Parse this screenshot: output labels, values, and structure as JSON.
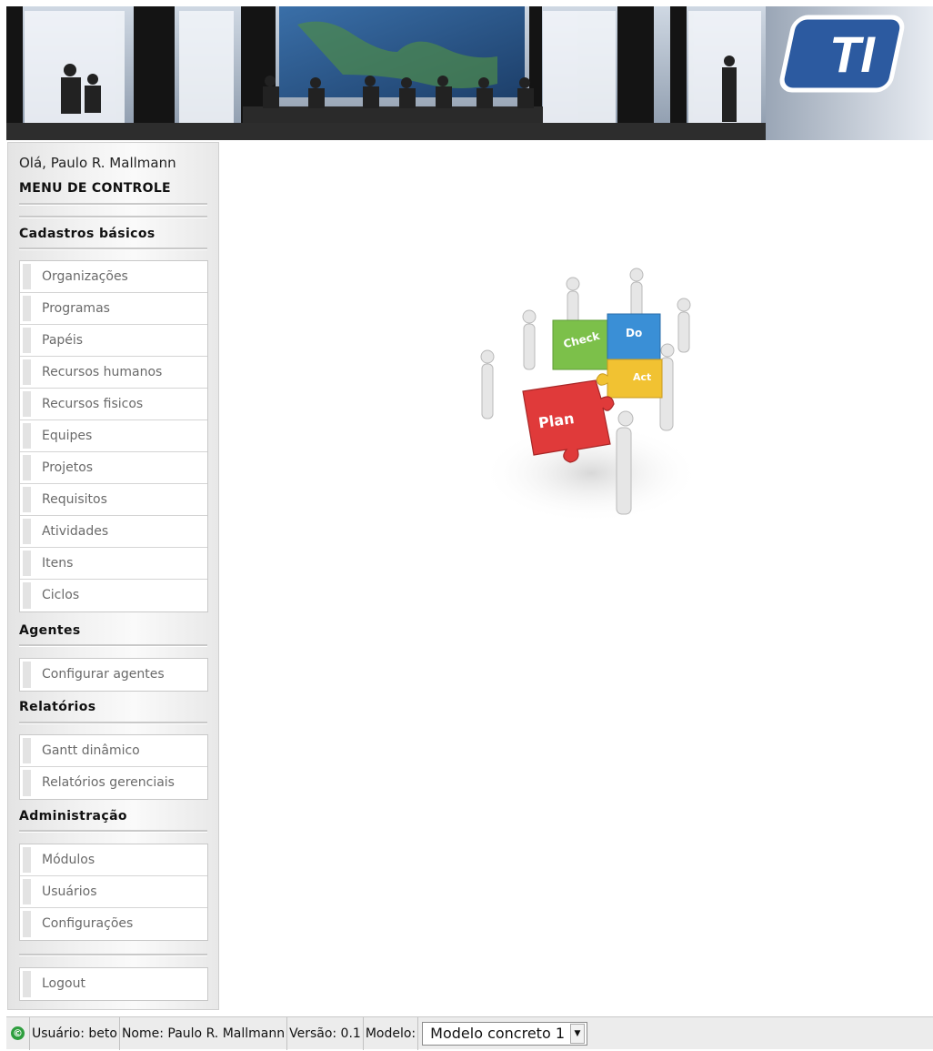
{
  "header": {
    "logo_text": "TI"
  },
  "sidebar": {
    "greeting": "Olá, Paulo R. Mallmann",
    "menu_title": "MENU DE CONTROLE",
    "sections": [
      {
        "title": "Cadastros básicos",
        "items": [
          "Organizações",
          "Programas",
          "Papéis",
          "Recursos humanos",
          "Recursos fisicos",
          "Equipes",
          "Projetos",
          "Requisitos",
          "Atividades",
          "Itens",
          "Ciclos"
        ]
      },
      {
        "title": "Agentes",
        "items": [
          "Configurar agentes"
        ]
      },
      {
        "title": "Relatórios",
        "items": [
          "Gantt dinâmico",
          "Relatórios gerenciais"
        ]
      },
      {
        "title": "Administração",
        "items": [
          "Módulos",
          "Usuários",
          "Configurações"
        ]
      }
    ],
    "logout": "Logout"
  },
  "main": {
    "pdca_labels": {
      "plan": "Plan",
      "do": "Do",
      "check": "Check",
      "act": "Act"
    },
    "puzzle_colors": {
      "plan": "#e03a3a",
      "do": "#3a8fd6",
      "check": "#7cc04a",
      "act": "#f1c232"
    }
  },
  "statusbar": {
    "copyright_icon": "copyright-icon",
    "user": "Usuário: beto",
    "name": "Nome: Paulo R. Mallmann",
    "version": "Versão: 0.1",
    "model_label": "Modelo:",
    "model_value": "Modelo concreto 1"
  }
}
